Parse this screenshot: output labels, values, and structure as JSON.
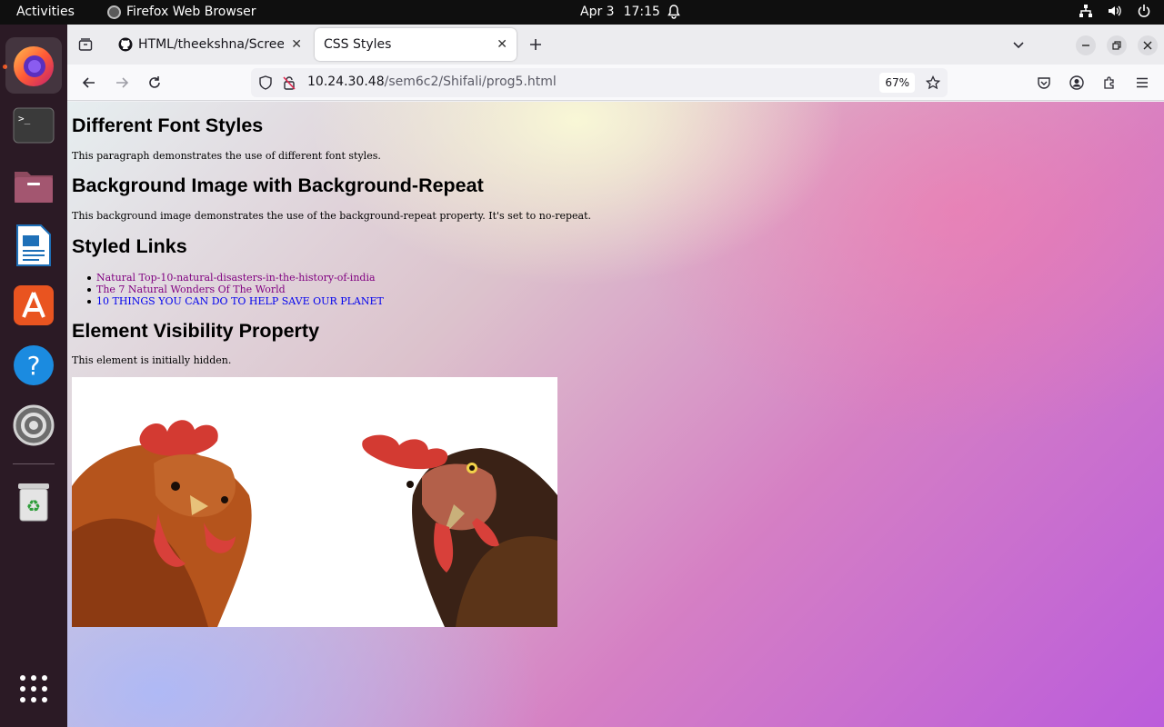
{
  "topbar": {
    "activities": "Activities",
    "app_name": "Firefox Web Browser",
    "date": "Apr 3",
    "time": "17:15"
  },
  "dock": {
    "items": [
      "firefox",
      "terminal",
      "files",
      "libreoffice-writer",
      "app-center",
      "help",
      "settings",
      "trash"
    ]
  },
  "browser": {
    "tabs": [
      {
        "label": "HTML/theekshna/Screen",
        "active": false
      },
      {
        "label": "CSS Styles",
        "active": true
      }
    ],
    "url_host": "10.24.30.48",
    "url_path": "/sem6c2/Shifali/prog5.html",
    "zoom": "67%"
  },
  "page": {
    "h_fonts": "Different Font Styles",
    "p_fonts": "This paragraph demonstrates the use of different font styles.",
    "h_background": "Background Image with Background-Repeat",
    "p_background": "This background image demonstrates the use of the background-repeat property. It's set to no-repeat.",
    "h_links": "Styled Links",
    "links": [
      {
        "text": "Natural Top-10-natural-disasters-in-the-history-of-india",
        "state": "visited"
      },
      {
        "text": "The 7 Natural Wonders Of The World",
        "state": "visited"
      },
      {
        "text": "10 THINGS YOU CAN DO TO HELP SAVE OUR PLANET",
        "state": "link"
      }
    ],
    "h_visibility": "Element Visibility Property",
    "p_visibility": "This element is initially hidden."
  },
  "colors": {
    "visited_link": "#800080",
    "link": "#0000ee",
    "ubuntu_orange": "#e95420"
  }
}
